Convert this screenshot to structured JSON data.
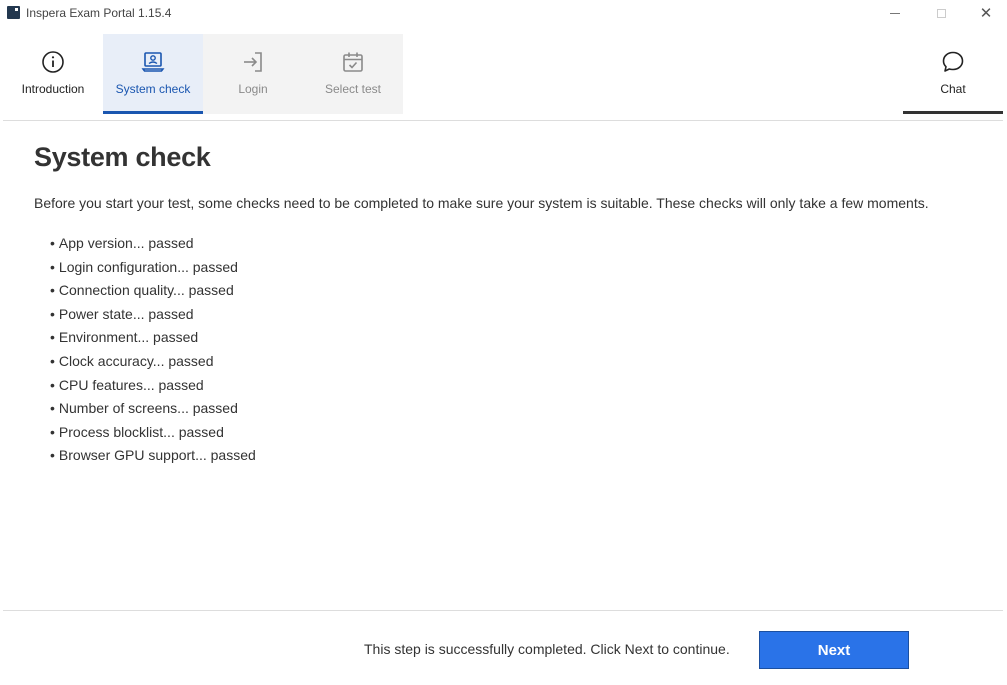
{
  "window": {
    "title": "Inspera Exam Portal 1.15.4",
    "close_glyph": "✕"
  },
  "tabs": [
    {
      "label": "Introduction",
      "icon": "info-circle-icon",
      "state": "completed"
    },
    {
      "label": "System check",
      "icon": "laptop-check-icon",
      "state": "active"
    },
    {
      "label": "Login",
      "icon": "login-arrow-icon",
      "state": "disabled"
    },
    {
      "label": "Select test",
      "icon": "calendar-check-icon",
      "state": "disabled"
    }
  ],
  "chat": {
    "label": "Chat",
    "icon": "chat-bubble-icon"
  },
  "main": {
    "title": "System check",
    "intro": "Before you start your test, some checks need to be completed to make sure your system is suitable. These checks will only take a few moments.",
    "checks": [
      "App version... passed",
      "Login configuration... passed",
      "Connection quality... passed",
      "Power state... passed",
      "Environment... passed",
      "Clock accuracy... passed",
      "CPU features... passed",
      "Number of screens... passed",
      "Process blocklist... passed",
      "Browser GPU support... passed"
    ]
  },
  "footer": {
    "status": "This step is successfully completed. Click Next to continue.",
    "next_label": "Next"
  },
  "colors": {
    "accent": "#1a56b0",
    "button": "#2a73e8",
    "active_tab_bg": "#e8eef8",
    "disabled_tab_bg": "#f3f3f3"
  }
}
